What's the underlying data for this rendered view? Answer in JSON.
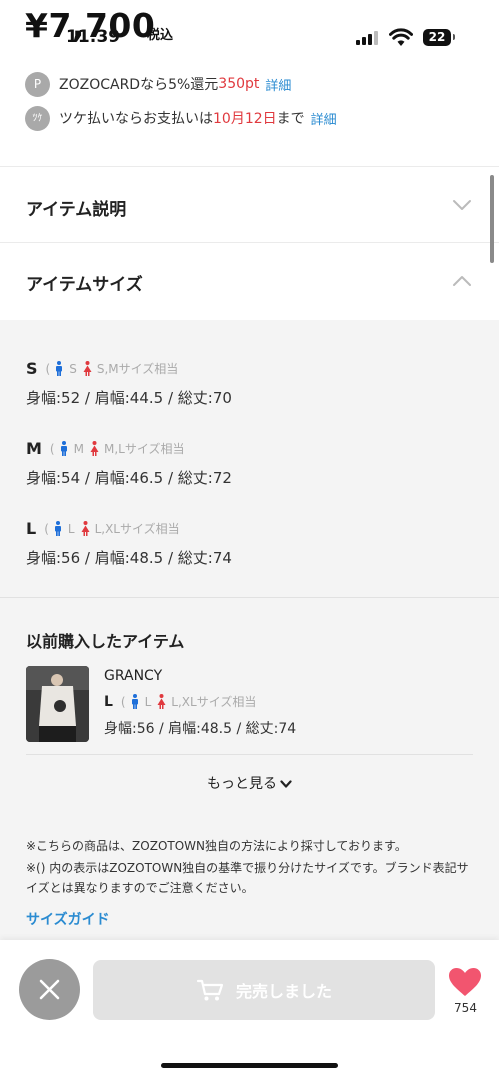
{
  "header": {
    "price": "¥7,700",
    "price_tax_label": "税込",
    "status_time": "11:39",
    "battery_level": "22"
  },
  "promos": [
    {
      "icon_text": "P",
      "icon": "points-icon",
      "prefix": "ZOZOCARDなら5%還元 ",
      "highlight": "350pt",
      "suffix": "",
      "link": "詳細"
    },
    {
      "icon_text": "ﾂｹ",
      "icon": "deferred-payment-icon",
      "prefix": "ツケ払いならお支払いは",
      "highlight": "10月12日",
      "suffix": "まで",
      "link": "詳細"
    }
  ],
  "accordions": {
    "description_title": "アイテム説明",
    "size_title": "アイテムサイズ"
  },
  "sizes": [
    {
      "name": "S",
      "men": "S",
      "women": "S,Mサイズ相当",
      "measurements": "身幅:52 / 肩幅:44.5 / 総丈:70"
    },
    {
      "name": "M",
      "men": "M",
      "women": "M,Lサイズ相当",
      "measurements": "身幅:54 / 肩幅:46.5 / 総丈:72"
    },
    {
      "name": "L",
      "men": "L",
      "women": "L,XLサイズ相当",
      "measurements": "身幅:56 / 肩幅:48.5 / 総丈:74"
    }
  ],
  "past_purchase": {
    "title": "以前購入したアイテム",
    "brand": "GRANCY",
    "size": "L",
    "men": "L",
    "women": "L,XLサイズ相当",
    "measurements": "身幅:56 / 肩幅:48.5 / 総丈:74",
    "more_label": "もっと見る"
  },
  "notes": [
    "※こちらの商品は、ZOZOTOWN独自の方法により採寸しております。",
    "※() 内の表示はZOZOTOWN独自の基準で振り分けたサイズです。ブランド表記サイズとは異なりますのでご注意ください。"
  ],
  "size_guide_label": "サイズガイド",
  "bottom_bar": {
    "soldout_label": "完売しました",
    "favorite_count": "754"
  },
  "colors": {
    "accent_red": "#e0393e",
    "link_blue": "#2a8bd1",
    "men_blue": "#1e6fd9",
    "women_red": "#e0393e",
    "heart_pink": "#f2556f"
  }
}
